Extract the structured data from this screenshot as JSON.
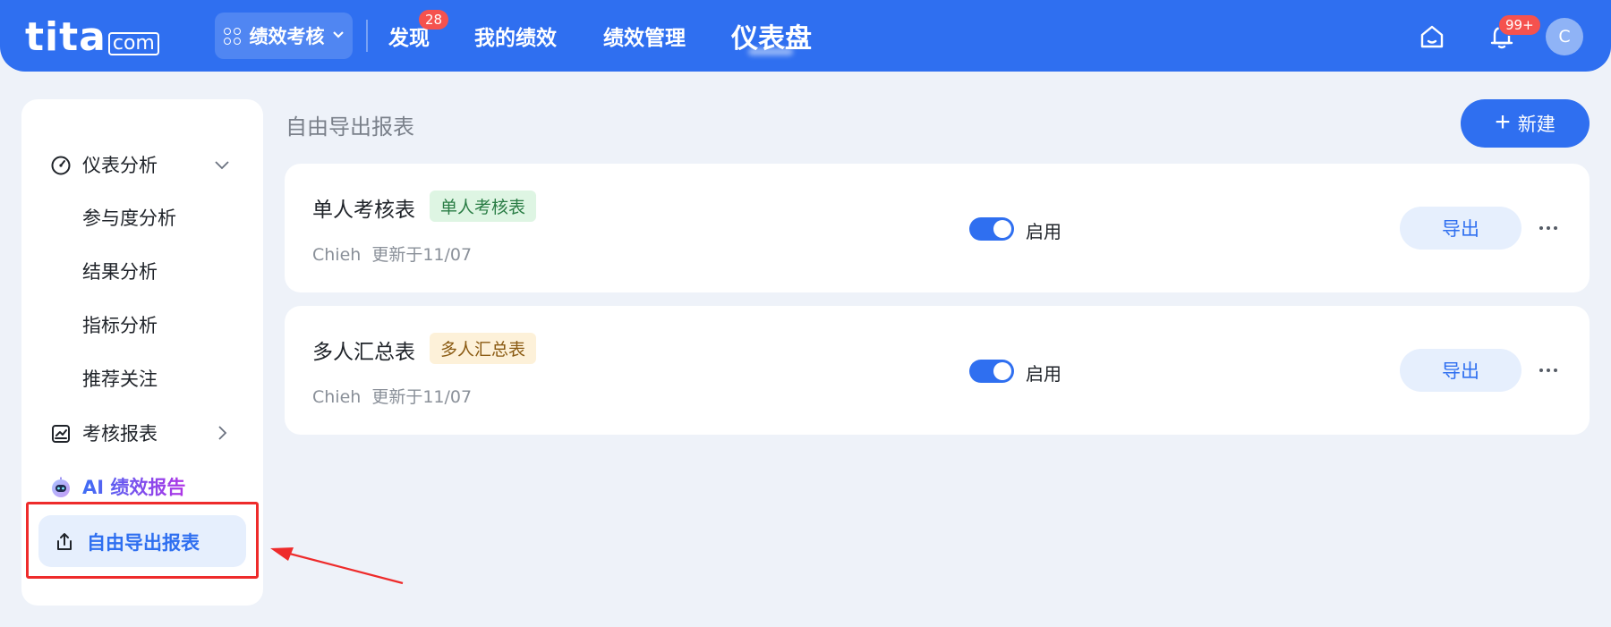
{
  "header": {
    "logo_main": "tita",
    "logo_domain": "com",
    "app_switcher_label": "绩效考核",
    "nav": [
      {
        "label": "发现",
        "badge": "28"
      },
      {
        "label": "我的绩效"
      },
      {
        "label": "绩效管理"
      },
      {
        "label": "仪表盘",
        "active": true
      }
    ],
    "notification_badge": "99+",
    "avatar_initial": "C"
  },
  "sidebar": {
    "sections": [
      {
        "label": "仪表分析",
        "icon": "gauge-icon",
        "expanded": true,
        "children": [
          "参与度分析",
          "结果分析",
          "指标分析",
          "推荐关注"
        ]
      },
      {
        "label": "考核报表",
        "icon": "chart-board-icon",
        "expanded": false
      },
      {
        "label": "AI 绩效报告",
        "icon": "ai-robot-icon"
      },
      {
        "label": "自由导出报表",
        "icon": "export-icon",
        "active": true
      }
    ]
  },
  "main": {
    "page_title": "自由导出报表",
    "new_button_label": "新建",
    "reports": [
      {
        "title": "单人考核表",
        "tag": "单人考核表",
        "tag_color": "#def5e3",
        "author": "Chieh",
        "updated": "更新于11/07",
        "status_label": "启用",
        "enabled": true,
        "export_label": "导出"
      },
      {
        "title": "多人汇总表",
        "tag": "多人汇总表",
        "tag_color": "#fdf1d9",
        "author": "Chieh",
        "updated": "更新于11/07",
        "status_label": "启用",
        "enabled": true,
        "export_label": "导出"
      }
    ]
  },
  "colors": {
    "primary": "#2f6ff0",
    "annotation": "#ee2b2b",
    "background": "#eef2f9"
  }
}
